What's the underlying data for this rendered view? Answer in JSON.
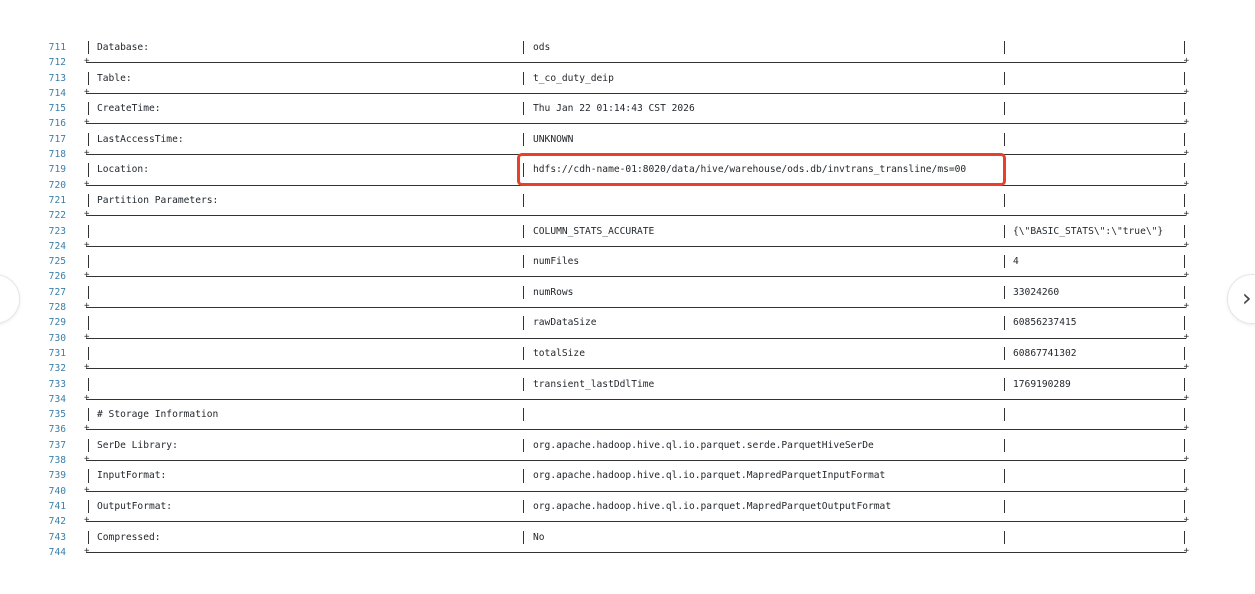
{
  "rows": [
    {
      "ln": "711",
      "c1": "Database:",
      "c2": "ods",
      "c3": ""
    },
    {
      "ln": "713",
      "c1": "Table:",
      "c2": "t_co_duty_deip",
      "c3": ""
    },
    {
      "ln": "715",
      "c1": "CreateTime:",
      "c2": "Thu Jan 22 01:14:43 CST 2026",
      "c3": ""
    },
    {
      "ln": "717",
      "c1": "LastAccessTime:",
      "c2": "UNKNOWN",
      "c3": ""
    },
    {
      "ln": "719",
      "c1": "Location:",
      "c2": "hdfs://cdh-name-01:8020/data/hive/warehouse/ods.db/invtrans_transline/ms=00",
      "c3": ""
    },
    {
      "ln": "721",
      "c1": "Partition Parameters:",
      "c2": "",
      "c3": ""
    },
    {
      "ln": "723",
      "c1": "",
      "c2": "COLUMN_STATS_ACCURATE",
      "c3": "{\\\"BASIC_STATS\\\":\\\"true\\\"}"
    },
    {
      "ln": "725",
      "c1": "",
      "c2": "numFiles",
      "c3": "4"
    },
    {
      "ln": "727",
      "c1": "",
      "c2": "numRows",
      "c3": "33024260"
    },
    {
      "ln": "729",
      "c1": "",
      "c2": "rawDataSize",
      "c3": "60856237415"
    },
    {
      "ln": "731",
      "c1": "",
      "c2": "totalSize",
      "c3": "60867741302"
    },
    {
      "ln": "733",
      "c1": "",
      "c2": "transient_lastDdlTime",
      "c3": "1769190289"
    },
    {
      "ln": "735",
      "c1": "# Storage Information",
      "c2": "",
      "c3": ""
    },
    {
      "ln": "737",
      "c1": "SerDe Library:",
      "c2": "org.apache.hadoop.hive.ql.io.parquet.serde.ParquetHiveSerDe",
      "c3": ""
    },
    {
      "ln": "739",
      "c1": "InputFormat:",
      "c2": "org.apache.hadoop.hive.ql.io.parquet.MapredParquetInputFormat",
      "c3": ""
    },
    {
      "ln": "741",
      "c1": "OutputFormat:",
      "c2": "org.apache.hadoop.hive.ql.io.parquet.MapredParquetOutputFormat",
      "c3": ""
    },
    {
      "ln": "743",
      "c1": "Compressed:",
      "c2": "No",
      "c3": ""
    }
  ],
  "separators": [
    "712",
    "714",
    "716",
    "718",
    "720",
    "722",
    "724",
    "726",
    "728",
    "730",
    "732",
    "734",
    "736",
    "738",
    "740",
    "742",
    "744"
  ],
  "nav": {
    "prev_icon": "chevron-left-icon",
    "next_icon": "chevron-right-icon",
    "next_glyph": "›"
  },
  "highlight_color": "#e8402c"
}
